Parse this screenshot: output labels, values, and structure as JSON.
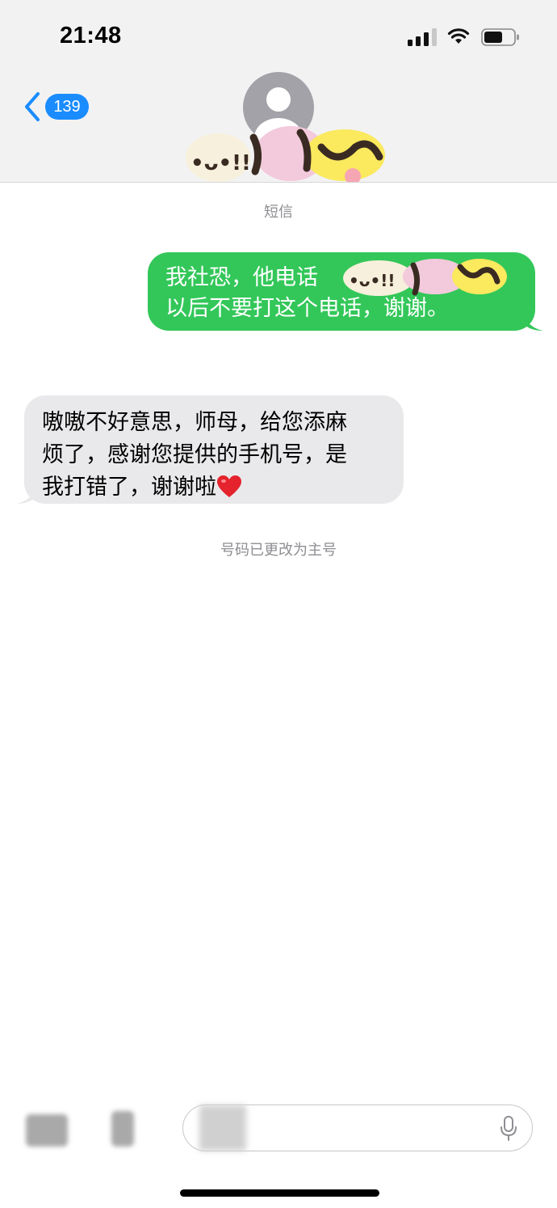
{
  "status_bar": {
    "time": "21:48",
    "icons": [
      "cellular-signal-icon",
      "wifi-icon",
      "battery-icon"
    ]
  },
  "nav": {
    "back_badge": "139",
    "contact_avatar": "person-icon",
    "contact_name_redacted": true
  },
  "conversation": {
    "service_label": "短信",
    "messages": [
      {
        "direction": "sent",
        "line1": "我社恐，他电话",
        "line2": "以后不要打这个电话，谢谢。",
        "bubble_color": "#33c759"
      },
      {
        "direction": "received",
        "line1": "嗷嗷不好意思，师母，给您添麻",
        "line2": "烦了，感谢您提供的手机号，是",
        "line3": "我打错了，谢谢啦",
        "emoji": "red-heart-icon",
        "bubble_color": "#e9e9eb"
      }
    ],
    "system_note": "号码已更改为主号"
  },
  "input_bar": {
    "icons": [
      "camera-icon",
      "apps-icon",
      "microphone-icon"
    ]
  },
  "colors": {
    "accent": "#1a8cff",
    "sent_bubble": "#33c759",
    "received_bubble": "#e9e9eb",
    "secondary_text": "#8e8e93"
  }
}
